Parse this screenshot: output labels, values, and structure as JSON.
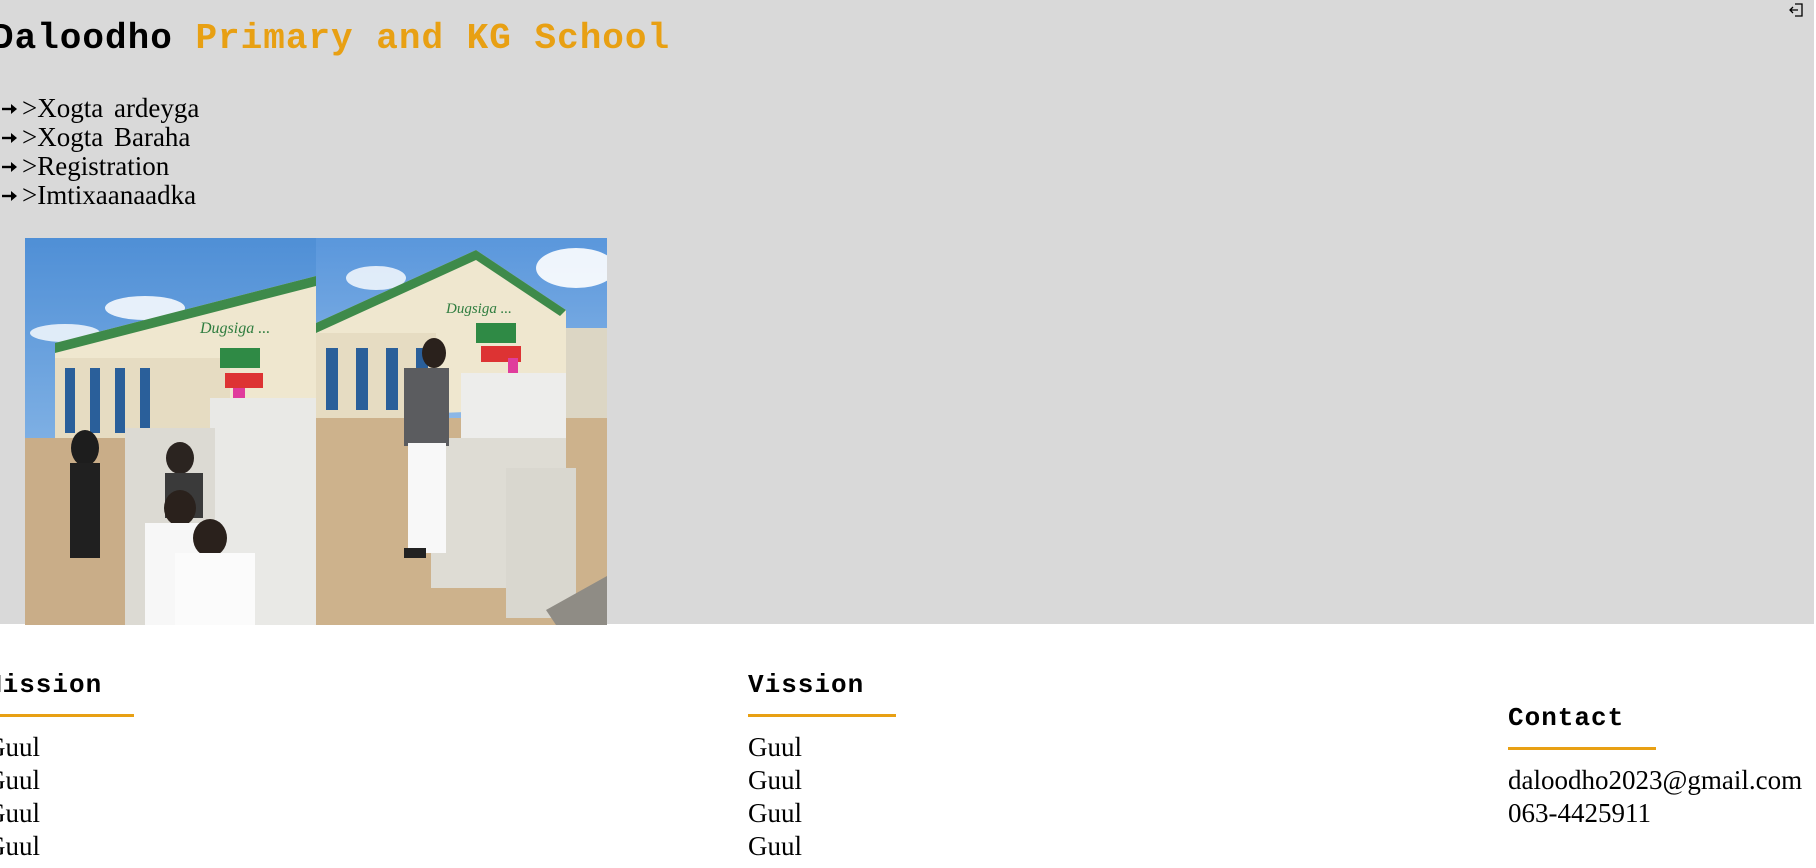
{
  "header": {
    "title_part1": "Daloodho",
    "title_part2": "Primary and KG School",
    "accent_color": "#e8a013",
    "logout_icon": "logout-icon"
  },
  "nav": {
    "items": [
      {
        "label": ">Xogta  ardeyga",
        "icon": "arrow-right-icon"
      },
      {
        "label": ">Xogta  Baraha",
        "icon": "arrow-right-icon"
      },
      {
        "label": ">Registration",
        "icon": "arrow-right-icon"
      },
      {
        "label": ">Imtixaanaadka",
        "icon": "arrow-right-icon"
      }
    ]
  },
  "mission": {
    "heading": "Mission",
    "lines": [
      "Guul",
      "Guul",
      "Guul",
      "Guul"
    ]
  },
  "vission": {
    "heading": "Vission",
    "lines": [
      "Guul",
      "Guul",
      "Guul",
      "Guul"
    ]
  },
  "contact": {
    "heading": "Contact",
    "email": "daloodho2023@gmail.com",
    "phone": "063-4425911"
  },
  "colors": {
    "hero_bg": "#d9d9d9",
    "accent": "#e8a013"
  }
}
